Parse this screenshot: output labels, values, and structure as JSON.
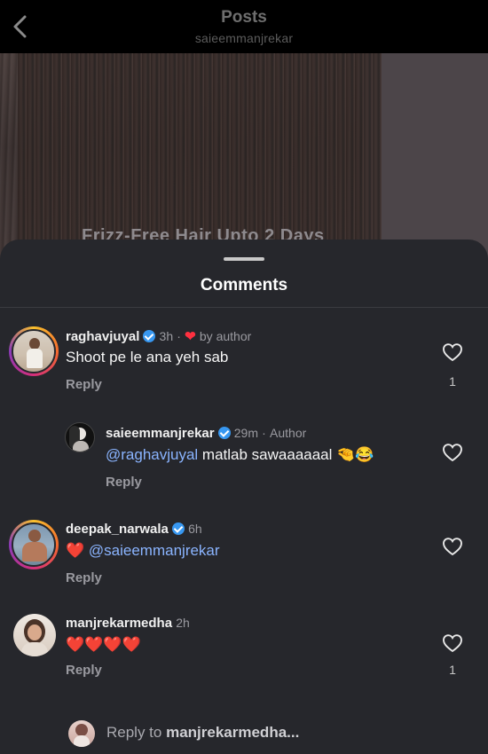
{
  "header": {
    "title": "Posts",
    "subtitle": "saieemmanjrekar"
  },
  "post": {
    "caption": "Frizz-Free Hair Upto 2 Days"
  },
  "sheet": {
    "title": "Comments"
  },
  "comments": [
    {
      "username": "raghavjuyal",
      "verified": true,
      "time": "3h",
      "sep": "·",
      "liked_badge": "by author",
      "text": "Shoot pe le ana yeh sab",
      "reply_label": "Reply",
      "like_count": "1"
    },
    {
      "username": "saieemmanjrekar",
      "verified": true,
      "time": "29m",
      "sep": "·",
      "role": "Author",
      "mention": "@raghavjuyal",
      "text": " matlab sawaaaaaal 🤏😂",
      "reply_label": "Reply"
    },
    {
      "username": "deepak_narwala",
      "verified": true,
      "time": "6h",
      "emoji": "❤️",
      "mention": "@saieemmanjrekar",
      "reply_label": "Reply"
    },
    {
      "username": "manjrekarmedha",
      "verified": false,
      "time": "2h",
      "text": "❤️❤️❤️❤️",
      "reply_label": "Reply",
      "like_count": "1"
    }
  ],
  "reply_bar": {
    "prefix": "Reply to ",
    "target": "manjrekarmedha..."
  },
  "colors": {
    "sheet_bg": "#26272c",
    "mention": "#8ab4ff",
    "verified": "#3797f0",
    "heart": "#ff3040"
  }
}
